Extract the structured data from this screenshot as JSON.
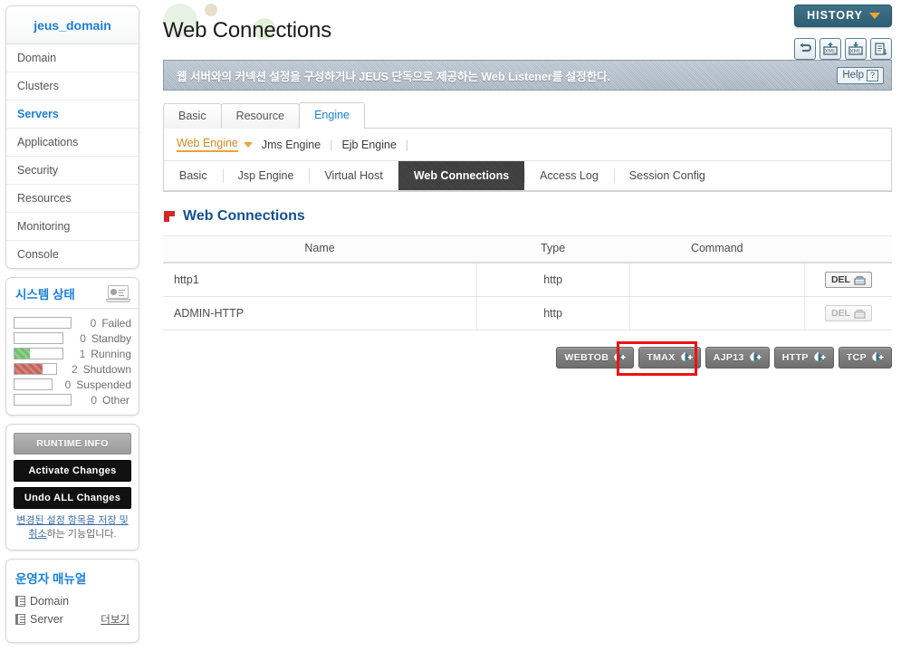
{
  "sidebar": {
    "domain_title": "jeus_domain",
    "nav_items": [
      {
        "label": "Domain",
        "active": false
      },
      {
        "label": "Clusters",
        "active": false
      },
      {
        "label": "Servers",
        "active": true
      },
      {
        "label": "Applications",
        "active": false
      },
      {
        "label": "Security",
        "active": false
      },
      {
        "label": "Resources",
        "active": false
      },
      {
        "label": "Monitoring",
        "active": false
      },
      {
        "label": "Console",
        "active": false
      }
    ],
    "system_status": {
      "title": "시스템 상태",
      "icon": "monitor-chart-icon",
      "rows": [
        {
          "count": "0",
          "label": "Failed",
          "pct": 0,
          "color": ""
        },
        {
          "count": "0",
          "label": "Standby",
          "pct": 0,
          "color": ""
        },
        {
          "count": "1",
          "label": "Running",
          "pct": 33,
          "color": "green"
        },
        {
          "count": "2",
          "label": "Shutdown",
          "pct": 66,
          "color": "red"
        },
        {
          "count": "0",
          "label": "Suspended",
          "pct": 0,
          "color": ""
        },
        {
          "count": "0",
          "label": "Other",
          "pct": 0,
          "color": ""
        }
      ]
    },
    "actions": {
      "runtime_info": "RUNTIME INFO",
      "activate_changes": "Activate Changes",
      "undo_all_changes": "Undo ALL Changes",
      "note_link": "변경된 설정 항목을 저장 및 취소",
      "note_tail": "하는 기능입니다."
    },
    "manual": {
      "title": "운영자 매뉴얼",
      "items": [
        {
          "label": "Domain"
        },
        {
          "label": "Server"
        }
      ],
      "more_label": "더보기"
    }
  },
  "header": {
    "page_title": "Web Connections",
    "history_label": "HISTORY",
    "toolbar_icons": [
      {
        "name": "refresh-icon",
        "title": "refresh"
      },
      {
        "name": "xml-upload-icon",
        "title": "XML upload"
      },
      {
        "name": "xml-download-icon",
        "title": "XML download"
      },
      {
        "name": "report-save-icon",
        "title": "report"
      }
    ]
  },
  "description": {
    "text": "웹 서버와의 커넥션 설정을 구성하거나 JEUS 단독으로 제공하는 Web Listener를 설정한다.",
    "help_label": "Help"
  },
  "tabs": [
    {
      "label": "Basic",
      "active": false
    },
    {
      "label": "Resource",
      "active": false
    },
    {
      "label": "Engine",
      "active": true
    }
  ],
  "engine_links": [
    {
      "label": "Web Engine",
      "active": true
    },
    {
      "label": "Jms Engine",
      "active": false
    },
    {
      "label": "Ejb Engine",
      "active": false
    }
  ],
  "subtabs": [
    {
      "label": "Basic",
      "active": false
    },
    {
      "label": "Jsp Engine",
      "active": false
    },
    {
      "label": "Virtual Host",
      "active": false
    },
    {
      "label": "Web Connections",
      "active": true
    },
    {
      "label": "Access Log",
      "active": false
    },
    {
      "label": "Session Config",
      "active": false
    }
  ],
  "section": {
    "title": "Web Connections",
    "icon": "red-square-icon"
  },
  "table": {
    "columns": [
      "Name",
      "Type",
      "Command",
      ""
    ],
    "rows": [
      {
        "name": "http1",
        "type": "http",
        "command": "",
        "action_label": "DEL",
        "action_enabled": true
      },
      {
        "name": "ADMIN-HTTP",
        "type": "http",
        "command": "",
        "action_label": "DEL",
        "action_enabled": false
      }
    ]
  },
  "connection_buttons": [
    {
      "label": "WEBTOB",
      "highlighted": true
    },
    {
      "label": "TMAX",
      "highlighted": false
    },
    {
      "label": "AJP13",
      "highlighted": false
    },
    {
      "label": "HTTP",
      "highlighted": false
    },
    {
      "label": "TCP",
      "highlighted": false
    }
  ],
  "colors": {
    "accent_blue": "#1a7fd4",
    "section_blue": "#14508f",
    "orange": "#e8a33d",
    "highlight_red": "#ee1111",
    "running_green": "#6fbf6f",
    "shutdown_red": "#c0655f",
    "history_teal": "#2e5f74"
  }
}
